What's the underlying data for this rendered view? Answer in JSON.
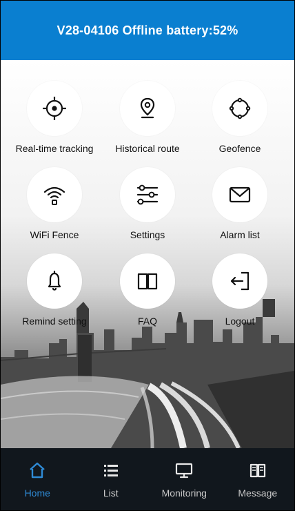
{
  "header": {
    "title": "V28-04106 Offline battery:52%"
  },
  "menu": {
    "items": [
      {
        "label": "Real-time tracking",
        "icon": "crosshair-icon"
      },
      {
        "label": "Historical route",
        "icon": "route-pin-icon"
      },
      {
        "label": "Geofence",
        "icon": "geofence-circle-icon"
      },
      {
        "label": "WiFi Fence",
        "icon": "wifi-icon"
      },
      {
        "label": "Settings",
        "icon": "sliders-icon"
      },
      {
        "label": "Alarm list",
        "icon": "envelope-icon"
      },
      {
        "label": "Remind setting",
        "icon": "bell-icon"
      },
      {
        "label": "FAQ",
        "icon": "book-icon"
      },
      {
        "label": "Logout",
        "icon": "logout-icon"
      }
    ]
  },
  "tabbar": {
    "tabs": [
      {
        "label": "Home",
        "icon": "home-icon",
        "active": true
      },
      {
        "label": "List",
        "icon": "list-icon",
        "active": false
      },
      {
        "label": "Monitoring",
        "icon": "monitor-icon",
        "active": false
      },
      {
        "label": "Message",
        "icon": "message-book-icon",
        "active": false
      }
    ]
  },
  "colors": {
    "header_bg": "#0A7FD0",
    "tab_active": "#2F8BD6",
    "tabbar_bg": "#11171D"
  }
}
